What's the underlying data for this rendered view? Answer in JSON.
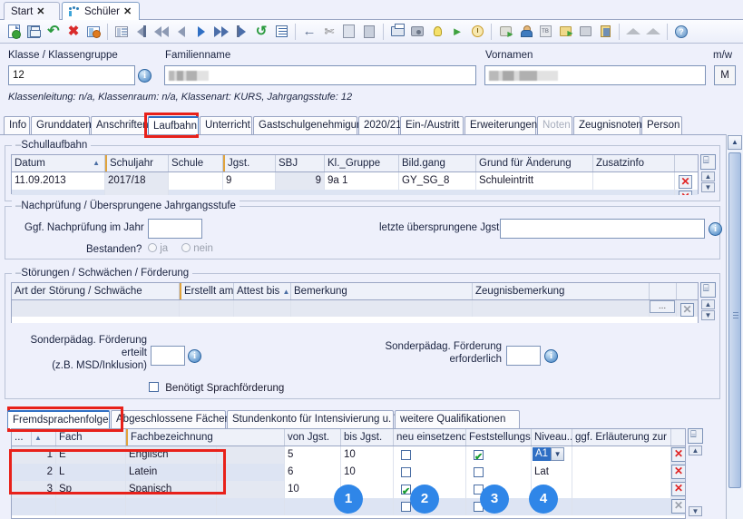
{
  "window_tabs": [
    {
      "label": "Start",
      "icon": "none",
      "close": "✕",
      "active": false
    },
    {
      "label": "Schüler",
      "icon": "students-icon",
      "close": "✕",
      "active": true
    }
  ],
  "toolbar": {
    "groups": [
      [
        "new-document-icon",
        "save-icon",
        "undo-icon",
        "delete-icon",
        "form-close-icon"
      ],
      [
        "grid-view-icon",
        "first-record-icon",
        "prev-page-icon",
        "prev-record-icon",
        "next-record-icon",
        "next-page-icon",
        "last-record-icon",
        "refresh-icon",
        "list-icon"
      ],
      [
        "back-icon",
        "cut-icon",
        "copy-icon",
        "paste-icon"
      ],
      [
        "print-icon",
        "print-preview-icon",
        "hint-icon",
        "announce-icon",
        "reminder-icon"
      ],
      [
        "export-icon",
        "student-icon",
        "tb-icon",
        "transfer-icon",
        "note-icon",
        "photo-icon"
      ],
      [
        "graduation-icon",
        "graduation2-icon"
      ],
      [
        "help-icon"
      ]
    ]
  },
  "header": {
    "klasse_label": "Klasse / Klassengruppe",
    "klasse_value": "12",
    "familienname_label": "Familienname",
    "familienname_value": "",
    "vornamen_label": "Vornamen",
    "vornamen_value": "",
    "mw_label": "m/w",
    "mw_value": "M",
    "subline": "Klassenleitung: n/a, Klassenraum: n/a, Klassenart: KURS, Jahrgangsstufe: 12"
  },
  "main_tabs": [
    {
      "label": "Info",
      "active": false,
      "disabled": false
    },
    {
      "label": "Grunddaten",
      "active": false,
      "disabled": false
    },
    {
      "label": "Anschriften",
      "active": false,
      "disabled": false
    },
    {
      "label": "Laufbahn",
      "active": true,
      "disabled": false
    },
    {
      "label": "Unterricht",
      "active": false,
      "disabled": false
    },
    {
      "label": "Gastschulgenehmigung",
      "active": false,
      "disabled": false
    },
    {
      "label": "2020/21",
      "active": false,
      "disabled": false
    },
    {
      "label": "Ein-/Austritt",
      "active": false,
      "disabled": false
    },
    {
      "label": "Erweiterungen",
      "active": false,
      "disabled": false
    },
    {
      "label": "Noten",
      "active": false,
      "disabled": true
    },
    {
      "label": "Zeugnisnoten",
      "active": false,
      "disabled": false
    },
    {
      "label": "Person",
      "active": false,
      "disabled": false
    }
  ],
  "schullaufbahn": {
    "title": "Schullaufbahn",
    "columns": [
      "Datum",
      "Schuljahr",
      "Schule",
      "Jgst.",
      "SBJ",
      "Kl._Gruppe",
      "Bild.gang",
      "Grund für Änderung",
      "Zusatzinfo",
      ""
    ],
    "sort_column": "Datum",
    "sort_dir": "▲",
    "rows": [
      {
        "datum": "11.09.2013",
        "schuljahr": "2017/18",
        "schule": "",
        "jgst": "9",
        "sbj": "9",
        "kl_gruppe": "9a 1",
        "bildgang": "GY_SG_8",
        "grund": "Schuleintritt",
        "zusatzinfo": ""
      }
    ],
    "delete_label": "✕"
  },
  "nachpruefung": {
    "title": "Nachprüfung / Übersprungene Jahrgangsstufe",
    "jahr_label": "Ggf. Nachprüfung im Jahr",
    "jahr_value": "",
    "bestanden_label": "Bestanden?",
    "ja_label": "ja",
    "nein_label": "nein",
    "letzte_label": "letzte übersprungene Jgst.",
    "letzte_value": ""
  },
  "stoerungen": {
    "title": "Störungen / Schwächen / Förderung",
    "columns": [
      "Art der Störung / Schwäche",
      "Erstellt am",
      "Attest bis",
      "Bemerkung",
      "Zeugnisbemerkung",
      "",
      ""
    ],
    "sort_column": "Attest bis",
    "sort_dir": "▲",
    "rows": [
      {
        "art": "",
        "erstellt": "",
        "attest": "",
        "bemerkung": "",
        "zeugnisbemerkung": ""
      }
    ],
    "dots_label": "...",
    "delete_label": "✕"
  },
  "foerderung": {
    "erteilt_label_1": "Sonderpädag. Förderung",
    "erteilt_label_2": "erteilt",
    "erteilt_label_3": "(z.B. MSD/Inklusion)",
    "erteilt_value": "",
    "erforderlich_label_1": "Sonderpädag. Förderung",
    "erforderlich_label_2": "erforderlich",
    "erforderlich_value": "",
    "sprach_label": "Benötigt Sprachförderung",
    "sprach_checked": false
  },
  "bottom_tabs": [
    {
      "label": "Fremdsprachenfolge",
      "active": true
    },
    {
      "label": "Abgeschlossene Fächer",
      "active": false
    },
    {
      "label": "Stundenkonto für Intensivierung u. WU",
      "active": false
    },
    {
      "label": "weitere Qualifikationen",
      "active": false
    }
  ],
  "fremdsprachen": {
    "columns": [
      "...",
      "Fach",
      "Fachbezeichnung",
      "",
      "von Jgst.",
      "bis Jgst.",
      "neu einsetzend...",
      "Feststellungs...",
      "Niveau...",
      "ggf. Erläuterung zur Fe...",
      ""
    ],
    "sort_column": "...",
    "sort_dir": "▲",
    "rows": [
      {
        "nr": "1",
        "fach": "E",
        "bezeichnung": "Englisch",
        "von": "5",
        "bis": "10",
        "neu": false,
        "feststellung": true,
        "niveau": "A1",
        "niveau_dropdown": true,
        "erlaeuterung": ""
      },
      {
        "nr": "2",
        "fach": "L",
        "bezeichnung": "Latein",
        "von": "6",
        "bis": "10",
        "neu": false,
        "feststellung": false,
        "niveau": "Lat",
        "niveau_dropdown": false,
        "erlaeuterung": ""
      },
      {
        "nr": "3",
        "fach": "Sp",
        "bezeichnung": "Spanisch",
        "von": "10",
        "bis": "",
        "neu": true,
        "feststellung": false,
        "niveau": "",
        "niveau_dropdown": false,
        "erlaeuterung": ""
      },
      {
        "nr": "",
        "fach": "",
        "bezeichnung": "",
        "von": "",
        "bis": "",
        "neu": false,
        "feststellung": false,
        "niveau": "",
        "niveau_dropdown": false,
        "erlaeuterung": ""
      }
    ],
    "delete_label": "✕"
  },
  "annotations": {
    "circles": [
      "1",
      "2",
      "3",
      "4"
    ],
    "highlight_color": "#e8211a",
    "circle_color": "#2f86e8"
  }
}
